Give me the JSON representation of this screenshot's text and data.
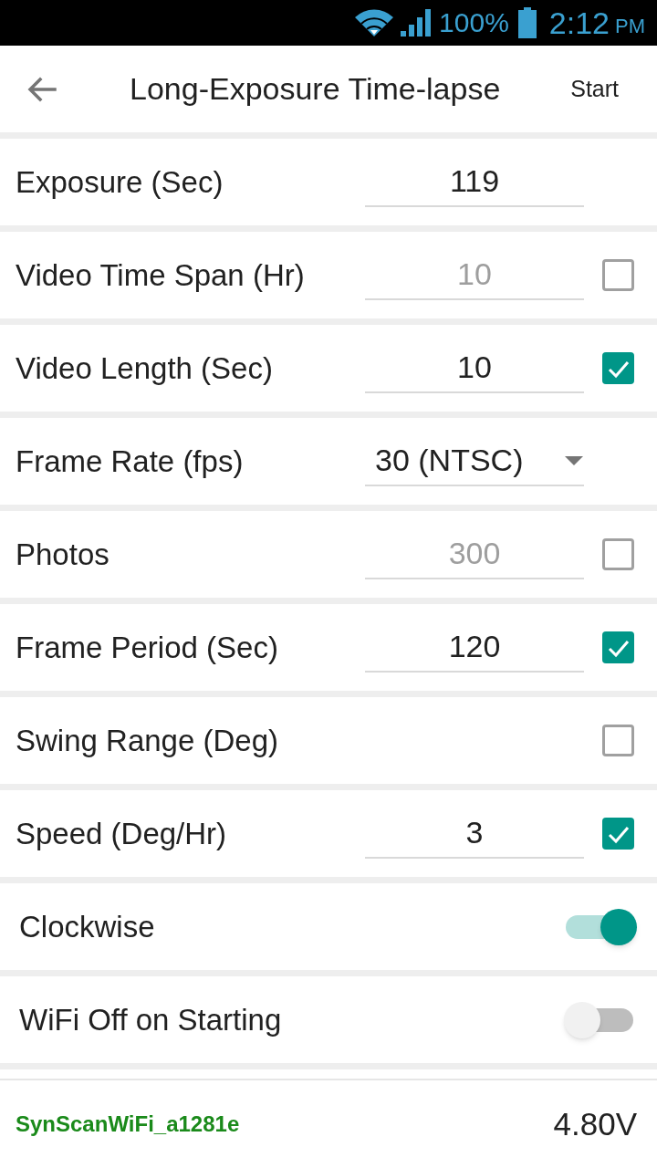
{
  "status_bar": {
    "battery": "100%",
    "time": "2:12",
    "period": "PM"
  },
  "app_bar": {
    "title": "Long-Exposure Time-lapse",
    "action": "Start"
  },
  "rows": [
    {
      "kind": "field",
      "label": "Exposure (Sec)",
      "field": {
        "value": "119",
        "disabled": false
      }
    },
    {
      "kind": "field",
      "label": "Video Time Span (Hr)",
      "field": {
        "value": "10",
        "disabled": true
      },
      "checkbox": {
        "checked": false
      }
    },
    {
      "kind": "field",
      "label": "Video Length (Sec)",
      "field": {
        "value": "10",
        "disabled": false
      },
      "checkbox": {
        "checked": true
      }
    },
    {
      "kind": "dropdown",
      "label": "Frame Rate (fps)",
      "dropdown": {
        "value": "30 (NTSC)"
      }
    },
    {
      "kind": "field",
      "label": "Photos",
      "field": {
        "value": "300",
        "disabled": true
      },
      "checkbox": {
        "checked": false
      }
    },
    {
      "kind": "field",
      "label": "Frame Period (Sec)",
      "field": {
        "value": "120",
        "disabled": false
      },
      "checkbox": {
        "checked": true
      }
    },
    {
      "kind": "field",
      "label": "Swing Range (Deg)",
      "checkbox": {
        "checked": false
      }
    },
    {
      "kind": "field",
      "label": "Speed (Deg/Hr)",
      "field": {
        "value": "3",
        "disabled": false
      },
      "checkbox": {
        "checked": true
      }
    },
    {
      "kind": "switch",
      "label": "Clockwise",
      "switch": {
        "on": true
      }
    },
    {
      "kind": "switch",
      "label": "WiFi Off on Starting",
      "switch": {
        "on": false
      }
    }
  ],
  "footer": {
    "device": "SynScanWiFi_a1281e",
    "voltage": "4.80V"
  }
}
